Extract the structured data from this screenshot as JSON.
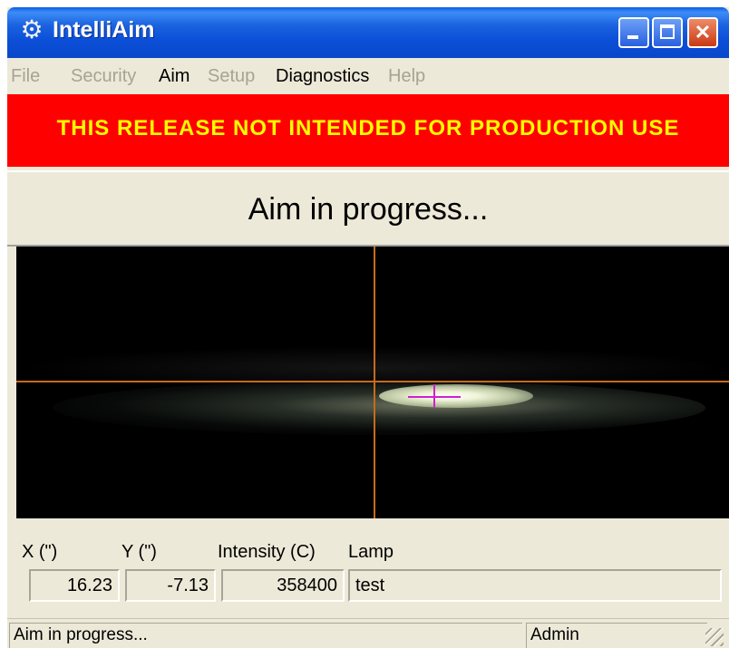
{
  "window": {
    "title": "IntelliAim",
    "app_icon": "gear-icon"
  },
  "menu": {
    "items": [
      {
        "label": "File",
        "enabled": false
      },
      {
        "label": "Security",
        "enabled": false
      },
      {
        "label": "Aim",
        "enabled": true
      },
      {
        "label": "Setup",
        "enabled": false
      },
      {
        "label": "Diagnostics",
        "enabled": true
      },
      {
        "label": "Help",
        "enabled": false
      }
    ]
  },
  "banner": {
    "text": "THIS RELEASE NOT INTENDED FOR PRODUCTION USE",
    "background": "#ff0000",
    "color": "#ffff00"
  },
  "status_header": {
    "text": "Aim in progress..."
  },
  "viewer": {
    "crosshair_color": "#c86a1a",
    "marker_color": "#d020d0"
  },
  "readout": {
    "labels": {
      "x": "X (\")",
      "y": "Y (\")",
      "intensity": "Intensity (C)",
      "lamp": "Lamp"
    },
    "values": {
      "x": "16.23",
      "y": "-7.13",
      "intensity": "358400",
      "lamp": "test"
    }
  },
  "statusbar": {
    "message": "Aim in progress...",
    "user": "Admin"
  }
}
